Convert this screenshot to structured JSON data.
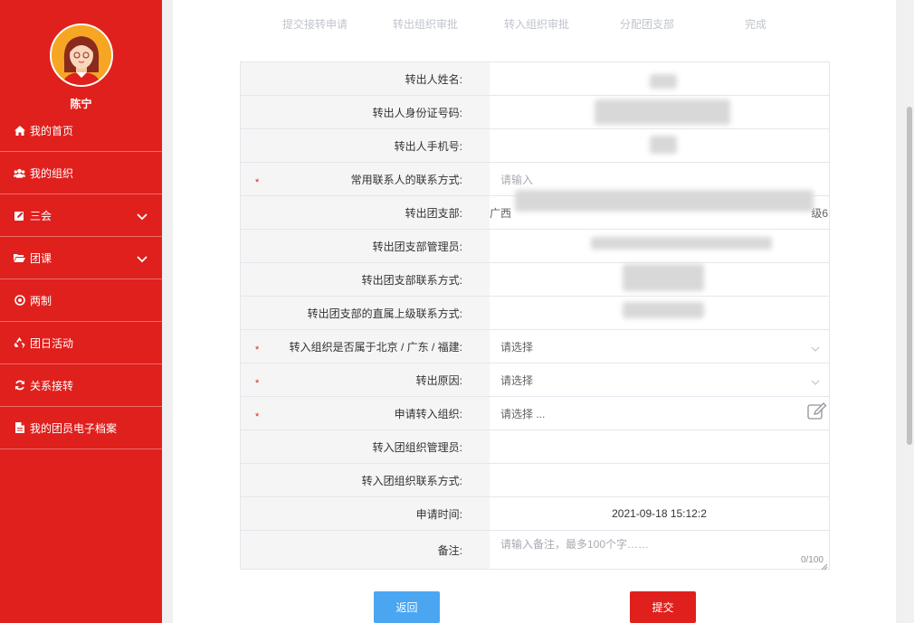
{
  "user": {
    "name": "陈宁"
  },
  "sidebar": {
    "items": [
      {
        "label": "我的首页",
        "icon": "home-icon",
        "expandable": false
      },
      {
        "label": "我的组织",
        "icon": "users-icon",
        "expandable": false
      },
      {
        "label": "三会",
        "icon": "edit-square-icon",
        "expandable": true
      },
      {
        "label": "团课",
        "icon": "folder-open-icon",
        "expandable": true
      },
      {
        "label": "两制",
        "icon": "target-icon",
        "expandable": false
      },
      {
        "label": "团日活动",
        "icon": "recycle-icon",
        "expandable": false
      },
      {
        "label": "关系接转",
        "icon": "refresh-icon",
        "expandable": false
      },
      {
        "label": "我的团员电子档案",
        "icon": "file-icon",
        "expandable": false
      }
    ]
  },
  "steps": [
    "提交接转申请",
    "转出组织审批",
    "转入组织审批",
    "分配团支部",
    "完成"
  ],
  "form": {
    "rows": [
      {
        "label": "转出人姓名:",
        "required": false,
        "value": "",
        "placeholder": ""
      },
      {
        "label": "转出人身份证号码:",
        "required": false,
        "value": "",
        "placeholder": ""
      },
      {
        "label": "转出人手机号:",
        "required": false,
        "value": "",
        "placeholder": ""
      },
      {
        "label": "常用联系人的联系方式:",
        "required": true,
        "value": "",
        "placeholder": "请输入"
      },
      {
        "label": "转出团支部:",
        "required": false,
        "value": "广西",
        "suffix": "级6",
        "placeholder": ""
      },
      {
        "label": "转出团支部管理员:",
        "required": false,
        "value": "",
        "placeholder": ""
      },
      {
        "label": "转出团支部联系方式:",
        "required": false,
        "value": "",
        "placeholder": ""
      },
      {
        "label": "转出团支部的直属上级联系方式:",
        "required": false,
        "value": "",
        "placeholder": ""
      },
      {
        "label": "转入组织是否属于北京 / 广东 / 福建:",
        "required": true,
        "value": "",
        "placeholder": "请选择"
      },
      {
        "label": "转出原因:",
        "required": true,
        "value": "",
        "placeholder": "请选择"
      },
      {
        "label": "申请转入组织:",
        "required": true,
        "value": "",
        "placeholder": "请选择 ..."
      },
      {
        "label": "转入团组织管理员:",
        "required": false,
        "value": "",
        "placeholder": ""
      },
      {
        "label": "转入团组织联系方式:",
        "required": false,
        "value": "",
        "placeholder": ""
      },
      {
        "label": "申请时间:",
        "required": false,
        "value": "2021-09-18 15:12:2",
        "placeholder": ""
      },
      {
        "label": "备注:",
        "required": false,
        "value": "",
        "placeholder": "请输入备注，最多100个字……",
        "counter": "0/100"
      }
    ]
  },
  "buttons": {
    "back": "返回",
    "submit": "提交"
  },
  "colors": {
    "brand_red": "#e0201d",
    "back_blue": "#4ba6f2",
    "required": "#e0201d"
  }
}
